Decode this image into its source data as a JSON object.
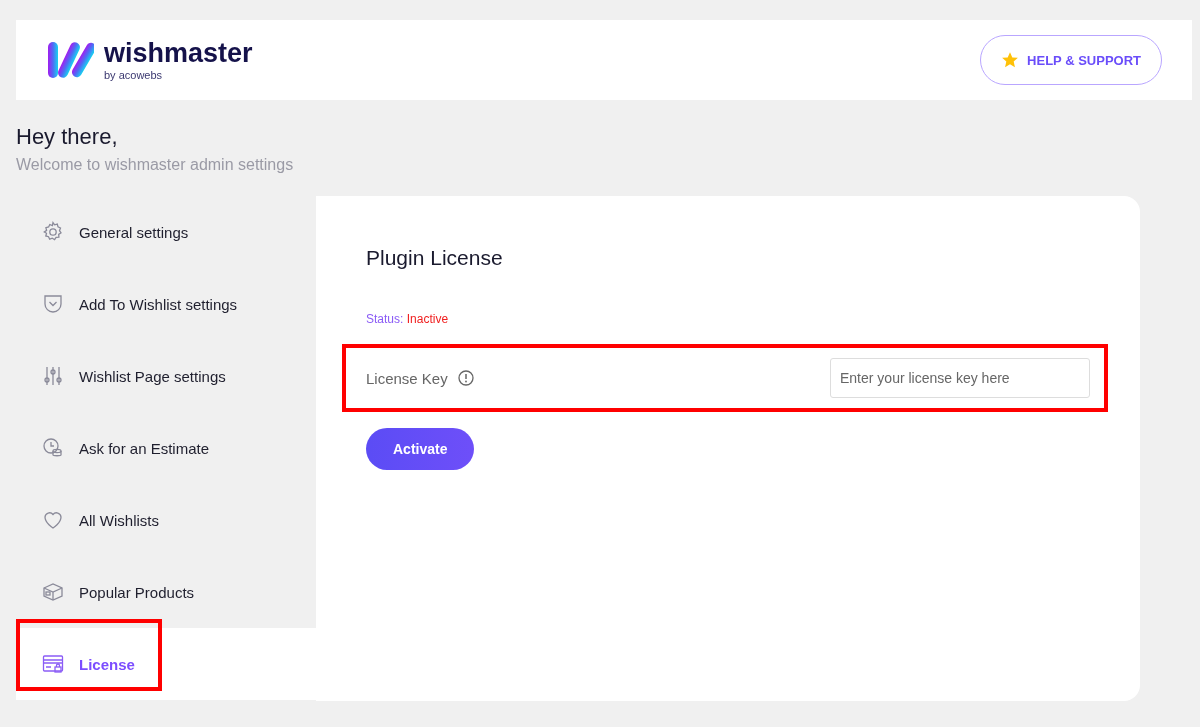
{
  "header": {
    "logo": {
      "name": "wishmaster",
      "byline": "by acowebs"
    },
    "help_button": "HELP & SUPPORT"
  },
  "greeting": {
    "title": "Hey there,",
    "subtitle": "Welcome to wishmaster admin settings"
  },
  "sidebar": {
    "items": [
      {
        "label": "General settings",
        "selected": false,
        "highlighted": false
      },
      {
        "label": "Add To Wishlist settings",
        "selected": false,
        "highlighted": false
      },
      {
        "label": "Wishlist Page settings",
        "selected": false,
        "highlighted": false
      },
      {
        "label": "Ask for an Estimate",
        "selected": false,
        "highlighted": false
      },
      {
        "label": "All Wishlists",
        "selected": false,
        "highlighted": false
      },
      {
        "label": "Popular Products",
        "selected": false,
        "highlighted": false
      },
      {
        "label": "License",
        "selected": true,
        "highlighted": true
      }
    ]
  },
  "content": {
    "title": "Plugin License",
    "status_label": "Status:",
    "status_value": "Inactive",
    "license_key": {
      "label": "License Key",
      "placeholder": "Enter your license key here",
      "highlighted": true
    },
    "activate_button": "Activate"
  }
}
